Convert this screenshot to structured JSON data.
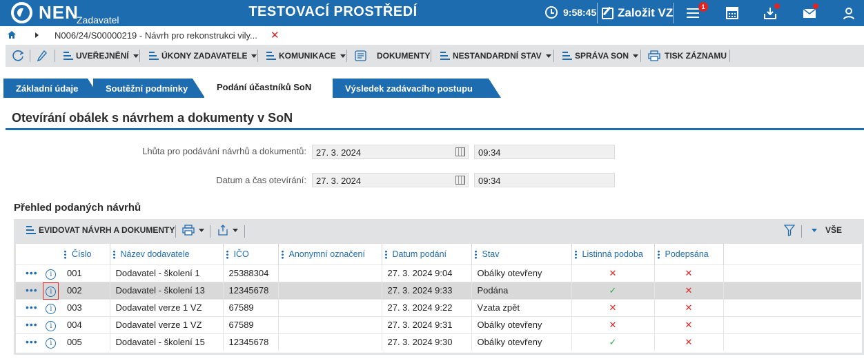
{
  "header": {
    "logo_text": "NEN",
    "logo_sub": "Zadavatel",
    "env_title": "TESTOVACÍ PROSTŘEDÍ",
    "time": "9:58:45",
    "create_label": "Založit VZ",
    "notification_count": "1"
  },
  "breadcrumb": {
    "text": "N006/24/S00000219 - Návrh pro rekonstrukci vily..."
  },
  "toolbar": {
    "publish": "UVEŘEJNĚNÍ",
    "actions": "ÚKONY ZADAVATELE",
    "communication": "KOMUNIKACE",
    "documents": "DOKUMENTY",
    "nonstandard": "NESTANDARDNÍ STAV",
    "son_admin": "SPRÁVA SON",
    "print": "TISK ZÁZNAMU"
  },
  "tabs": [
    {
      "label": "Základní údaje"
    },
    {
      "label": "Soutěžní podmínky"
    },
    {
      "label": "Podání účastníků SoN"
    },
    {
      "label": "Výsledek zadávacího postupu"
    }
  ],
  "section_title": "Otevírání obálek s návrhem a dokumenty v SoN",
  "form": {
    "deadline_label": "Lhůta pro podávání návrhů a dokumentů:",
    "deadline_date": "27. 3. 2024",
    "deadline_time": "09:34",
    "opening_label": "Datum a čas otevírání:",
    "opening_date": "27. 3. 2024",
    "opening_time": "09:34"
  },
  "list": {
    "title": "Přehled podaných návrhů",
    "record_button": "EVIDOVAT NÁVRH A DOKUMENTY",
    "filter_all": "VŠE",
    "columns": [
      "Číslo",
      "Název dodavatele",
      "IČO",
      "Anonymní označení",
      "Datum podání",
      "Stav",
      "Listinná podoba",
      "Podepsána"
    ],
    "rows": [
      {
        "cislo": "001",
        "nazev": "Dodavatel - školení 1",
        "ico": "25388304",
        "anon": "",
        "datum": "27. 3. 2024 9:04",
        "stav": "Obálky otevřeny",
        "listinna": "x",
        "podepsana": "x"
      },
      {
        "cislo": "002",
        "nazev": "Dodavatel - školení 13",
        "ico": "12345678",
        "anon": "",
        "datum": "27. 3. 2024 9:33",
        "stav": "Podána",
        "listinna": "check",
        "podepsana": "x"
      },
      {
        "cislo": "003",
        "nazev": "Dodavatel verze 1 VZ",
        "ico": "67589",
        "anon": "",
        "datum": "27. 3. 2024 9:22",
        "stav": "Vzata zpět",
        "listinna": "x",
        "podepsana": "x"
      },
      {
        "cislo": "004",
        "nazev": "Dodavatel verze 1 VZ",
        "ico": "67589",
        "anon": "",
        "datum": "27. 3. 2024 9:31",
        "stav": "Obálky otevřeny",
        "listinna": "x",
        "podepsana": "x"
      },
      {
        "cislo": "005",
        "nazev": "Dodavatel - školení 15",
        "ico": "12345678",
        "anon": "",
        "datum": "27. 3. 2024 9:30",
        "stav": "Obálky otevřeny",
        "listinna": "check",
        "podepsana": "x"
      }
    ]
  },
  "colors": {
    "brand_blue": "#1e6cb0",
    "toolbar_gray": "#e1e2e3",
    "error_red": "#e02424",
    "ok_green": "#2fa84f"
  }
}
